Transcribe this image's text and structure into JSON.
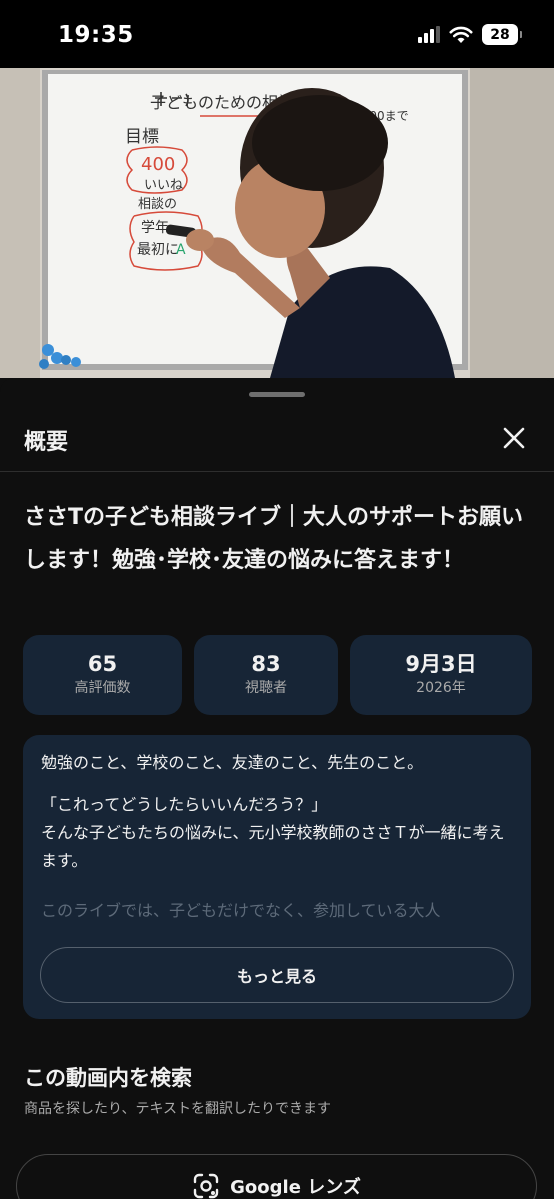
{
  "status_bar": {
    "time": "19:35",
    "battery": "28"
  },
  "sheet": {
    "title": "概要",
    "video_title": "ささTの子ども相談ライブ｜大人のサポートお願いします！勉強･学校･友達の悩みに答えます！",
    "stats": [
      {
        "value": "65",
        "label": "高評価数"
      },
      {
        "value": "83",
        "label": "視聴者"
      },
      {
        "value": "9月3日",
        "label": "2026年"
      }
    ],
    "description": {
      "line1": "勉強のこと、学校のこと、友達のこと、先生のこと。",
      "line2": "「これってどうしたらいいんだろう？」",
      "line3": "そんな子どもたちの悩みに、元小学校教師のささＴが一緒に考えます。",
      "line4_faded": "このライブでは、子どもだけでなく、参加している大人",
      "more_label": "もっと見る"
    },
    "search_section": {
      "title": "この動画内を検索",
      "subtitle": "商品を探したり、テキストを翻訳したりできます",
      "lens_label": "Google レンズ"
    }
  },
  "icons": {
    "signal": "signal-icon",
    "wifi": "wifi-icon",
    "close": "close-icon",
    "lens": "google-lens-icon"
  },
  "colors": {
    "background": "#0f0f0f",
    "card": "#172536",
    "text": "#f1f1f1",
    "secondary": "#aaaaaa"
  },
  "video": {
    "whiteboard_lines": [
      "子どものための相談ライブ",
      "21:00まで",
      "目標",
      "400",
      "いいね",
      "相談の",
      "学年",
      "最初に"
    ]
  }
}
